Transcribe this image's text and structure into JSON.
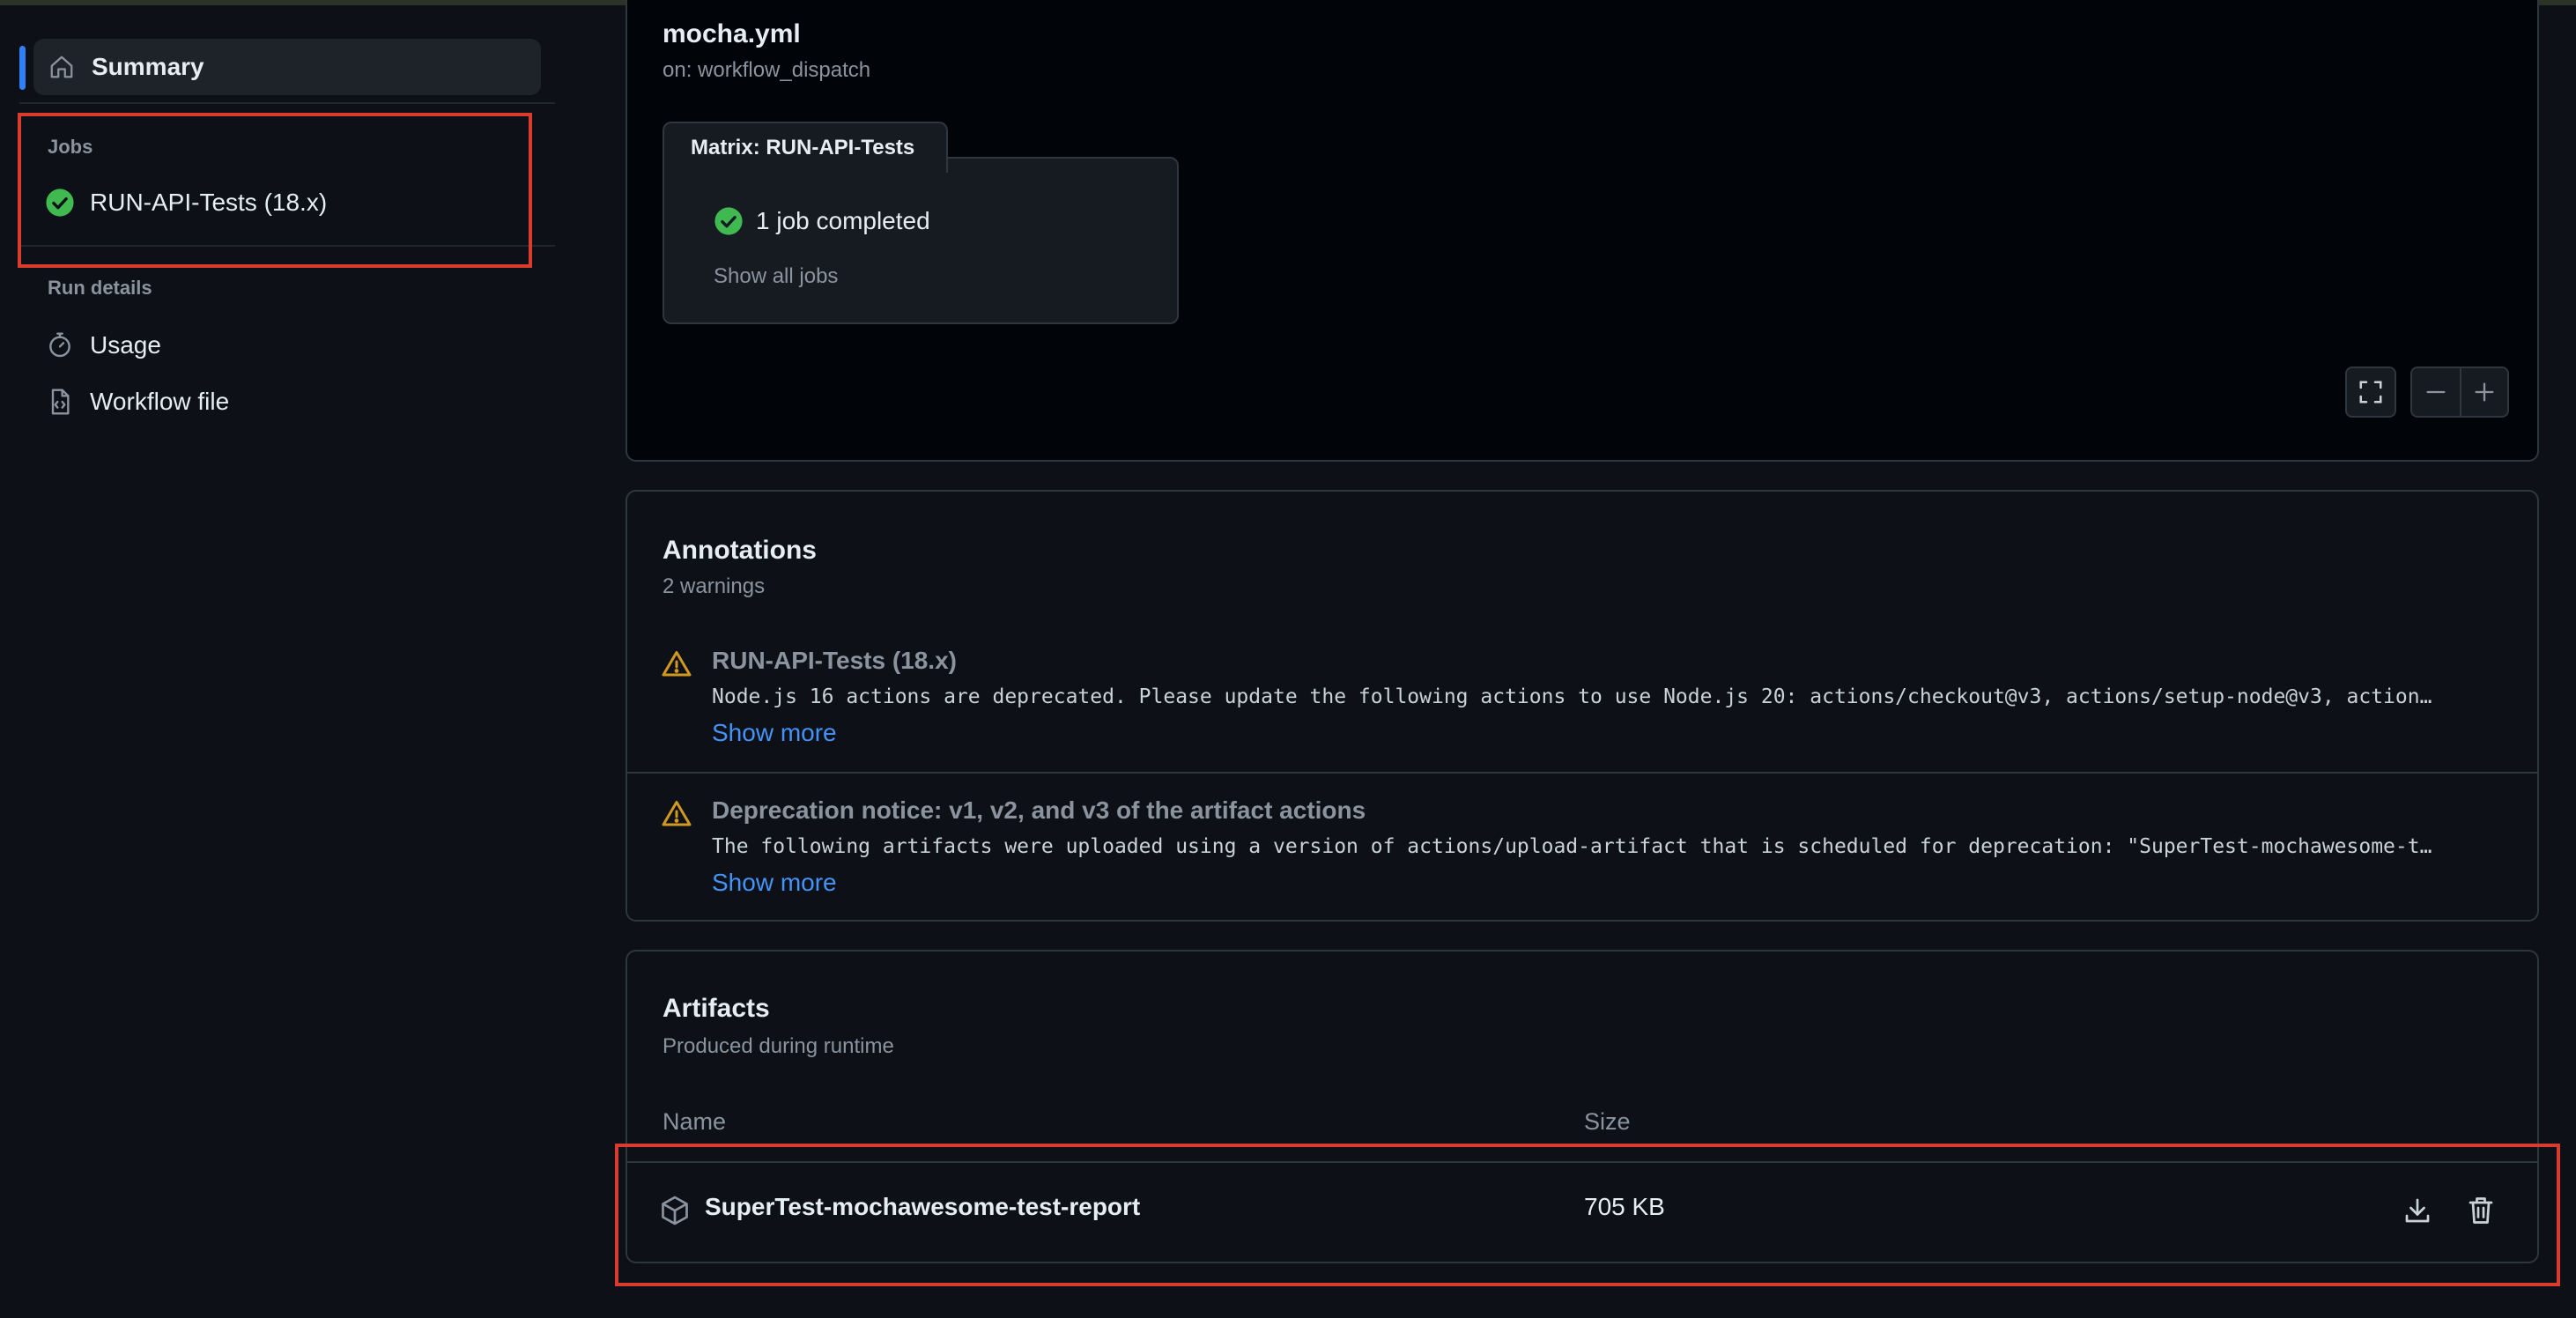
{
  "sidebar": {
    "summary_label": "Summary",
    "jobs_heading": "Jobs",
    "jobs": [
      {
        "label": "RUN-API-Tests (18.x)",
        "status": "success"
      }
    ],
    "run_details_heading": "Run details",
    "run_details": [
      {
        "label": "Usage",
        "icon": "stopwatch-icon"
      },
      {
        "label": "Workflow file",
        "icon": "file-code-icon"
      }
    ]
  },
  "graph": {
    "workflow_name": "mocha.yml",
    "trigger": "on: workflow_dispatch",
    "matrix_tab": "Matrix: RUN-API-Tests",
    "jobs_completed": "1 job completed",
    "show_all_jobs": "Show all jobs",
    "controls": {
      "fullscreen_icon": "fullscreen-icon",
      "zoom_out_icon": "minus-icon",
      "zoom_in_icon": "plus-icon"
    }
  },
  "annotations": {
    "title": "Annotations",
    "subtitle": "2 warnings",
    "items": [
      {
        "title": "RUN-API-Tests (18.x)",
        "message": "Node.js 16 actions are deprecated. Please update the following actions to use Node.js 20: actions/checkout@v3, actions/setup-node@v3, action…",
        "link": "Show more"
      },
      {
        "title": "Deprecation notice: v1, v2, and v3 of the artifact actions",
        "message": "The following artifacts were uploaded using a version of actions/upload-artifact that is scheduled for deprecation: \"SuperTest-mochawesome-t…",
        "link": "Show more"
      }
    ]
  },
  "artifacts": {
    "title": "Artifacts",
    "subtitle": "Produced during runtime",
    "columns": {
      "name": "Name",
      "size": "Size"
    },
    "rows": [
      {
        "name": "SuperTest-mochawesome-test-report",
        "size": "705 KB"
      }
    ]
  },
  "colors": {
    "success": "#3fb950",
    "warning": "#d29922",
    "link": "#4493f8",
    "highlight": "#da3b2f",
    "accent": "#2f81f7"
  }
}
